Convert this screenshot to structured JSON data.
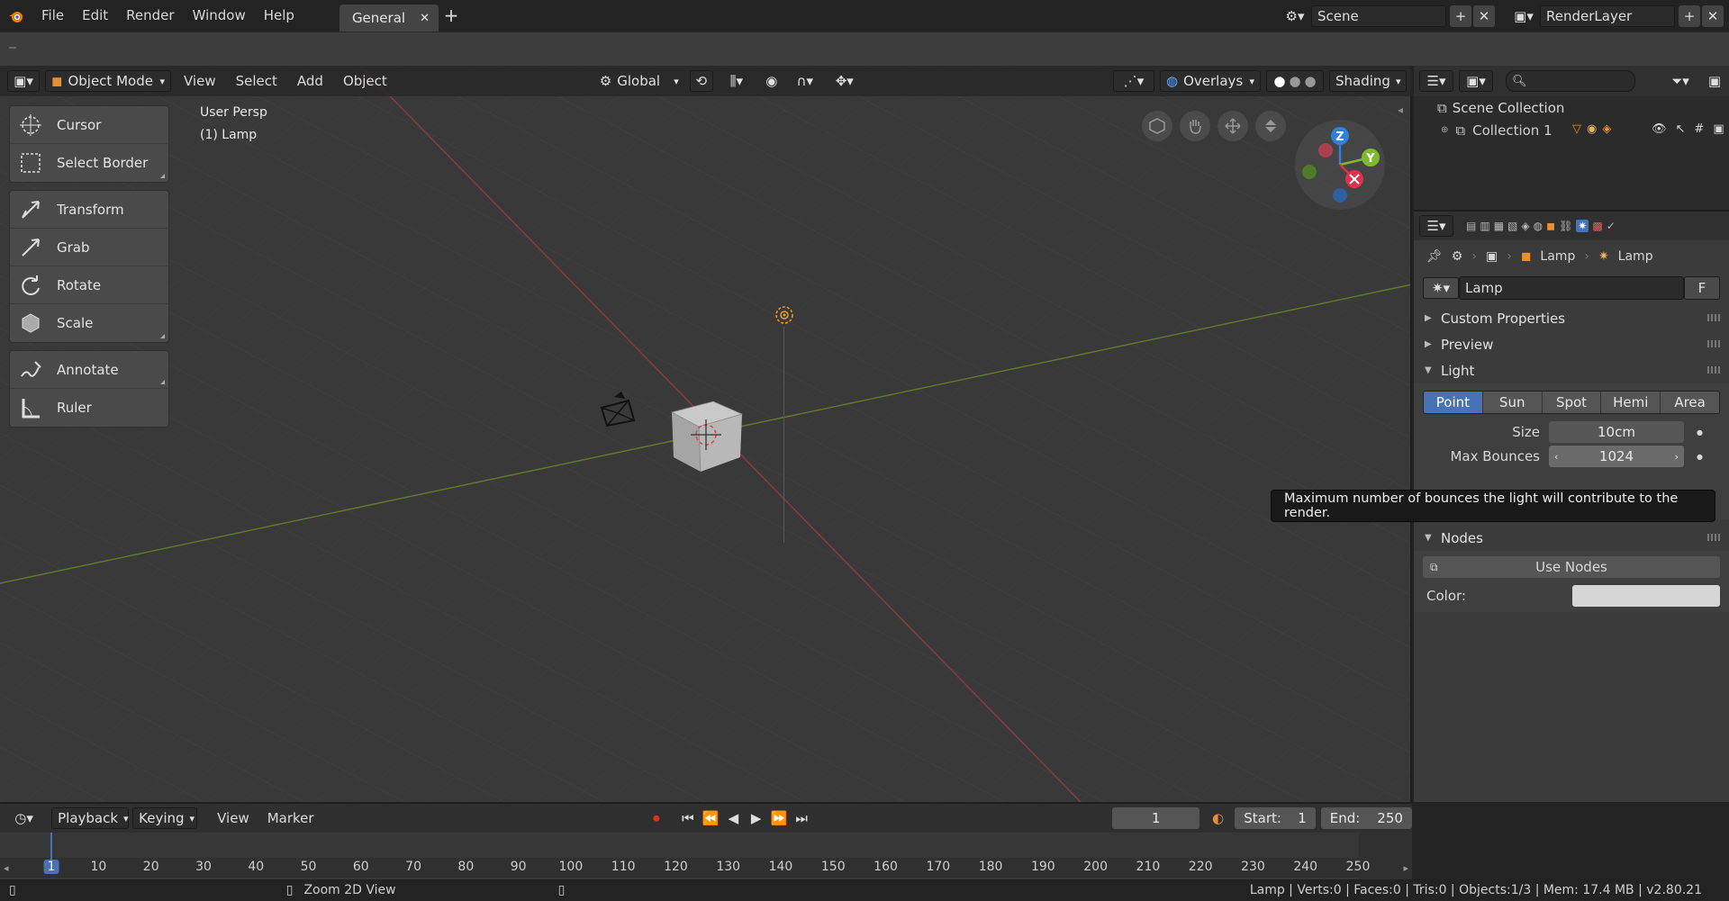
{
  "topbar": {
    "menus": [
      "File",
      "Edit",
      "Render",
      "Window",
      "Help"
    ],
    "workspace_tab": "General",
    "scene_name": "Scene",
    "render_layer": "RenderLayer"
  },
  "viewport_header": {
    "mode": "Object Mode",
    "menus": [
      "View",
      "Select",
      "Add",
      "Object"
    ],
    "orientation": "Global",
    "overlays": "Overlays",
    "shading": "Shading"
  },
  "toolbar": {
    "tools": [
      "Cursor",
      "Select Border",
      "Transform",
      "Grab",
      "Rotate",
      "Scale",
      "Annotate",
      "Ruler"
    ]
  },
  "viewport": {
    "view_label": "User Persp",
    "object_label": "(1) Lamp",
    "gizmo": {
      "z": "Z",
      "y": "Y"
    },
    "colors": {
      "x_axis": "#c8323c",
      "y_axis": "#6a9a2a",
      "z_axis": "#2f7fe0"
    }
  },
  "outliner": {
    "scene_collection": "Scene Collection",
    "collection": "Collection 1"
  },
  "properties": {
    "breadcrumb_object": "Lamp",
    "breadcrumb_data": "Lamp",
    "datablock_name": "Lamp",
    "fake_user": "F",
    "panels": {
      "custom_properties": "Custom Properties",
      "preview": "Preview",
      "light": "Light",
      "nodes": "Nodes"
    },
    "light_types": [
      "Point",
      "Sun",
      "Spot",
      "Hemi",
      "Area"
    ],
    "active_light_type": "Point",
    "size_label": "Size",
    "size_value": "10cm",
    "max_bounces_label": "Max Bounces",
    "max_bounces_value": "1024",
    "use_nodes": "Use Nodes",
    "color_label": "Color:",
    "color_value": "#d6d6d6"
  },
  "tooltip": "Maximum number of bounces the light will contribute to the render.",
  "timeline": {
    "menus": [
      "Playback",
      "Keying",
      "View",
      "Marker"
    ],
    "current_frame": "1",
    "start_label": "Start:",
    "start_value": "1",
    "end_label": "End:",
    "end_value": "250",
    "ruler_ticks": [
      "1",
      "10",
      "20",
      "30",
      "40",
      "50",
      "60",
      "70",
      "80",
      "90",
      "100",
      "110",
      "120",
      "130",
      "140",
      "150",
      "160",
      "170",
      "180",
      "190",
      "200",
      "210",
      "220",
      "230",
      "240",
      "250"
    ]
  },
  "statusbar": {
    "hint": "Zoom 2D View",
    "stats": "Lamp | Verts:0 | Faces:0 | Tris:0 | Objects:1/3 | Mem: 17.4 MB | v2.80.21"
  }
}
